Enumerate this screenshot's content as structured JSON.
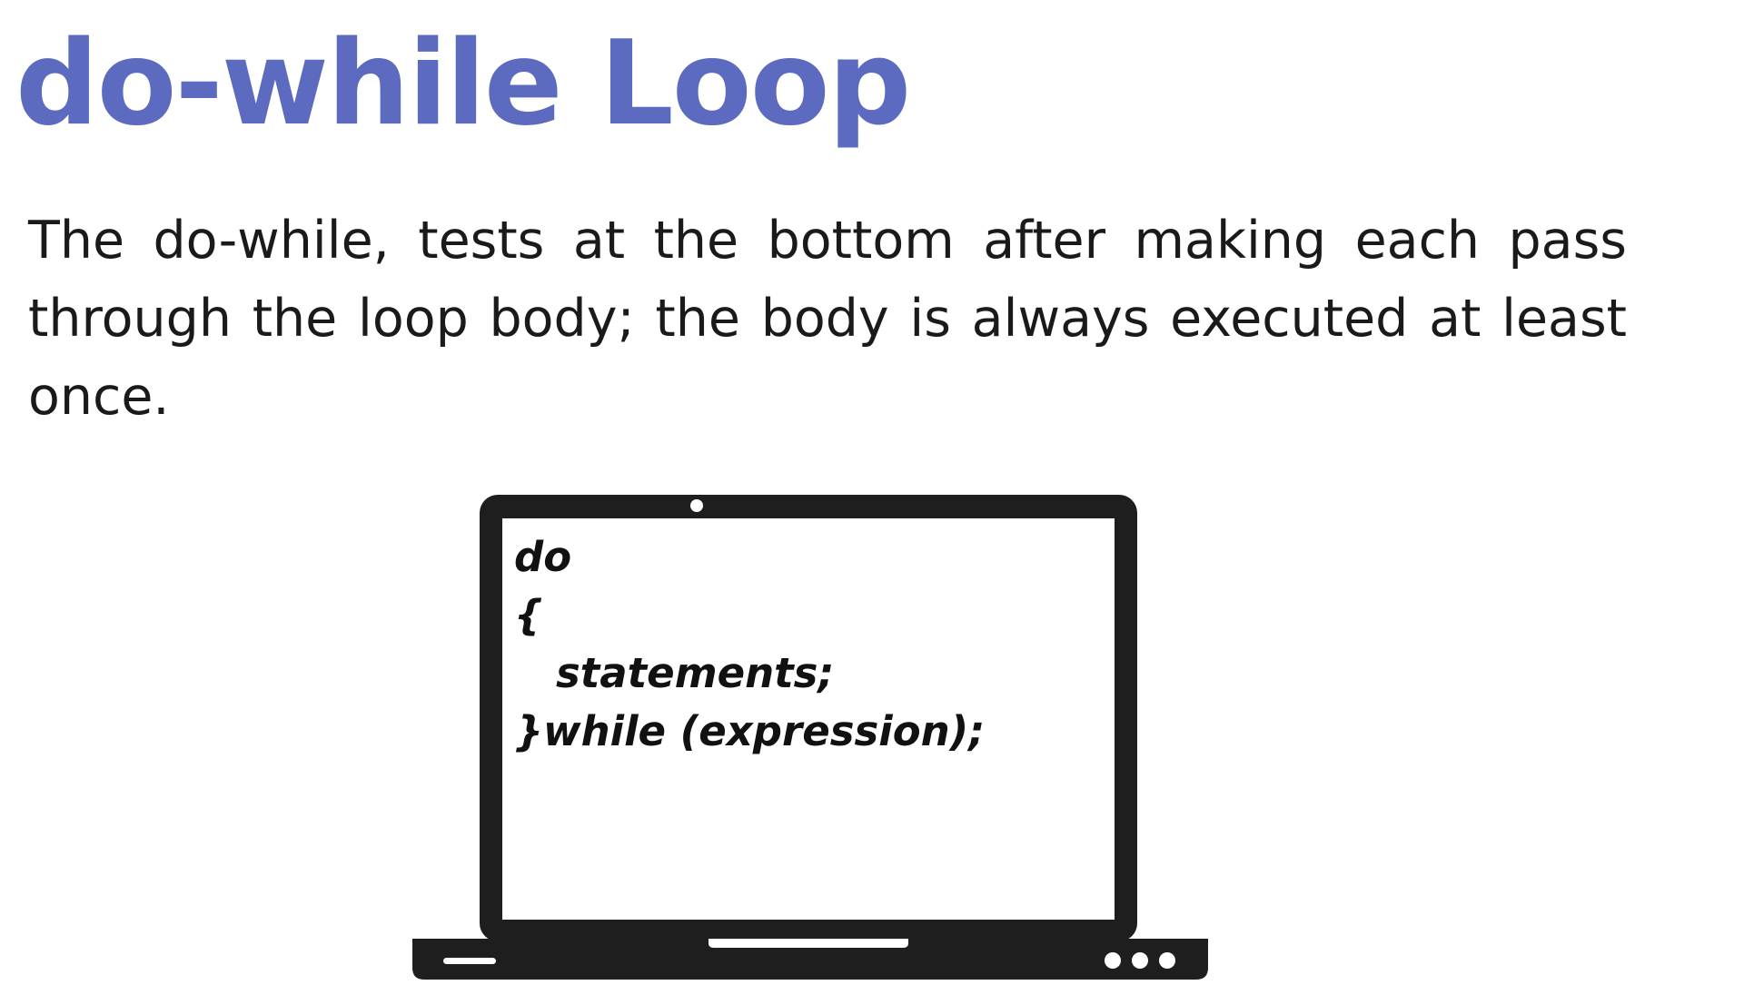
{
  "slide": {
    "title": "do-while Loop",
    "body": "The do-while, tests at the bottom after making each pass through the loop body; the body is always executed at least once."
  },
  "illustration": {
    "icon": "laptop-icon",
    "code_lines": [
      "do",
      "{",
      "statements;",
      "}while (expression);"
    ]
  },
  "colors": {
    "title": "#5c6bc0",
    "body_text": "#1a1a1a",
    "laptop": "#1e1e1e",
    "background": "#ffffff"
  }
}
